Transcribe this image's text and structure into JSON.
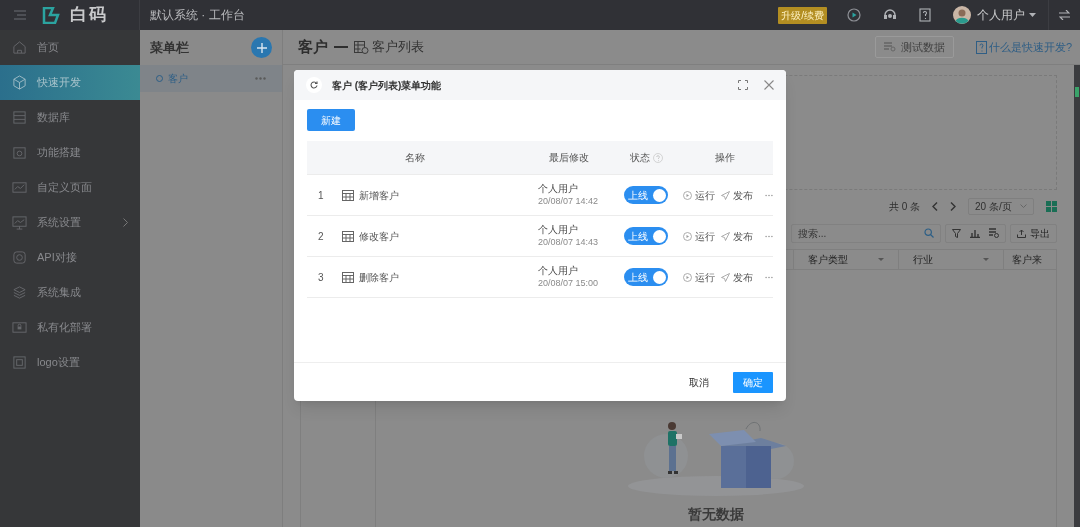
{
  "topbar": {
    "brand": "白码",
    "breadcrumb": "默认系统 · 工作台",
    "upgrade_badge": "升级/续费",
    "user_name": "个人用户"
  },
  "sidebar": {
    "items": [
      {
        "label": "首页",
        "selected": false,
        "expandable": false
      },
      {
        "label": "快速开发",
        "selected": true,
        "expandable": false
      },
      {
        "label": "数据库",
        "selected": false,
        "expandable": false
      },
      {
        "label": "功能搭建",
        "selected": false,
        "expandable": false
      },
      {
        "label": "自定义页面",
        "selected": false,
        "expandable": false
      },
      {
        "label": "系统设置",
        "selected": false,
        "expandable": true
      },
      {
        "label": "API对接",
        "selected": false,
        "expandable": false
      },
      {
        "label": "系统集成",
        "selected": false,
        "expandable": false
      },
      {
        "label": "私有化部署",
        "selected": false,
        "expandable": false
      },
      {
        "label": "logo设置",
        "selected": false,
        "expandable": false
      }
    ]
  },
  "menu_panel": {
    "title": "菜单栏",
    "items": [
      {
        "label": "客户",
        "selected": true
      }
    ]
  },
  "page_header": {
    "title": "客户",
    "subtitle": "客户列表",
    "test_data_button": "测试数据",
    "help_link": "什么是快速开发?"
  },
  "list_toolbar": {
    "total": "共 0 条",
    "page_size": "20 条/页",
    "search_placeholder": "搜索...",
    "export_button": "导出"
  },
  "list_columns": [
    "客户类型",
    "行业",
    "客户来"
  ],
  "empty_text": "暂无数据",
  "dialog": {
    "title": "客户 (客户列表)菜单功能",
    "new_button": "新建",
    "columns": [
      "名称",
      "最后修改",
      "状态",
      "操作"
    ],
    "rows": [
      {
        "index": "1",
        "name": "新增客户",
        "modified_by": "个人用户",
        "modified_at": "20/08/07 14:42",
        "status_label": "上线",
        "on": true,
        "run": "运行",
        "publish": "发布"
      },
      {
        "index": "2",
        "name": "修改客户",
        "modified_by": "个人用户",
        "modified_at": "20/08/07 14:43",
        "status_label": "上线",
        "on": true,
        "run": "运行",
        "publish": "发布"
      },
      {
        "index": "3",
        "name": "删除客户",
        "modified_by": "个人用户",
        "modified_at": "20/08/07 15:00",
        "status_label": "上线",
        "on": true,
        "run": "运行",
        "publish": "发布"
      }
    ],
    "cancel_button": "取消",
    "ok_button": "确定"
  }
}
